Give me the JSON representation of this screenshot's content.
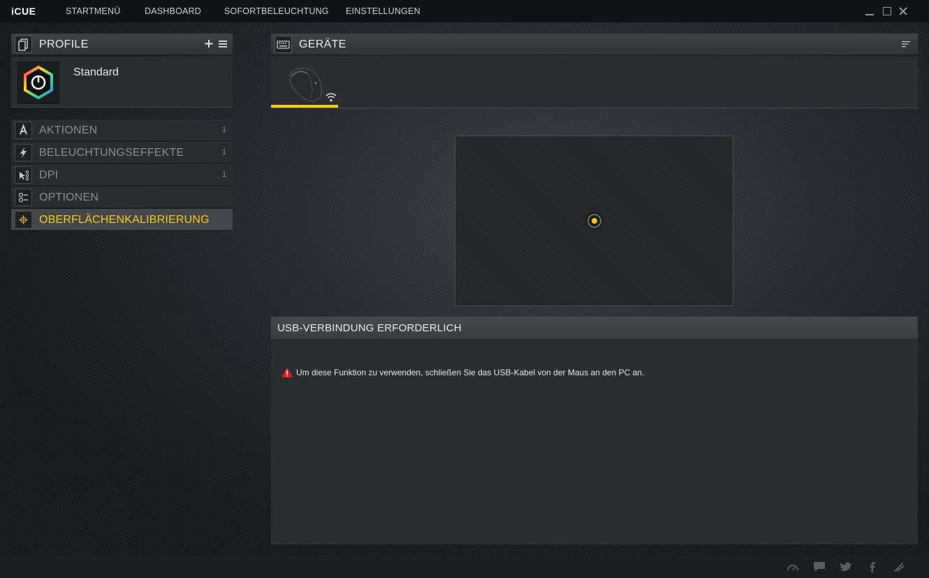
{
  "app": {
    "logo": "iCUE"
  },
  "nav": [
    {
      "label": "STARTMENÜ"
    },
    {
      "label": "DASHBOARD"
    },
    {
      "label": "SOFORTBELEUCHTUNG"
    },
    {
      "label": "EINSTELLUNGEN"
    }
  ],
  "profiles": {
    "header": "PROFILE",
    "current": "Standard"
  },
  "menu": [
    {
      "label": "AKTIONEN",
      "count": "1",
      "icon": "letter-a-icon",
      "active": false
    },
    {
      "label": "BELEUCHTUNGSEFFEKTE",
      "count": "1",
      "icon": "lightning-icon",
      "active": false
    },
    {
      "label": "DPI",
      "count": "1",
      "icon": "dpi-pointer-icon",
      "active": false
    },
    {
      "label": "OPTIONEN",
      "count": "",
      "icon": "options-toggle-icon",
      "active": false
    },
    {
      "label": "OBERFLÄCHENKALIBRIERUNG",
      "count": "",
      "icon": "crosshair-icon",
      "active": true
    }
  ],
  "devices": {
    "header": "GERÄTE",
    "selected_device_icon": "mouse-icon",
    "connection_icon": "wireless-icon"
  },
  "usb": {
    "header": "USB-VERBINDUNG ERFORDERLICH",
    "message": "Um diese Funktion zu verwenden, schließen Sie das USB-Kabel von der Maus an den PC an."
  },
  "colors": {
    "accent": "#f2cd14",
    "warning": "#e02020"
  }
}
